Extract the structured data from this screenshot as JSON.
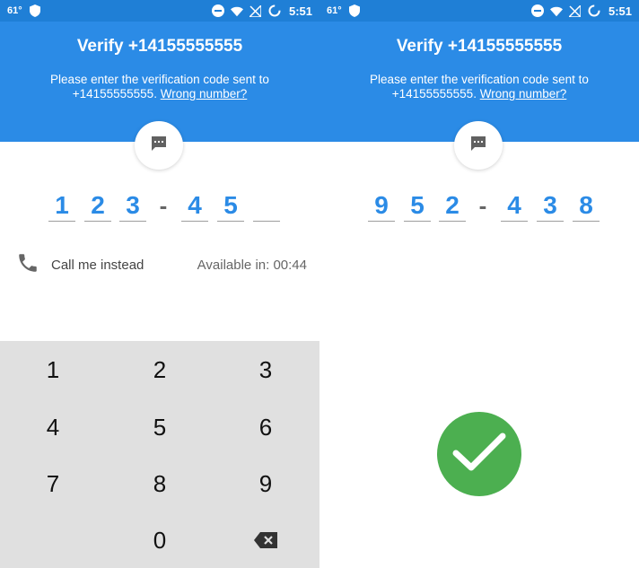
{
  "status_bar": {
    "temperature": "61°",
    "time": "5:51"
  },
  "left": {
    "title": "Verify +14155555555",
    "subtitle_text": "Please enter the verification code sent to +14155555555.",
    "wrong_number_link": "Wrong number?",
    "code_digits": [
      "1",
      "2",
      "3",
      "4",
      "5",
      ""
    ],
    "separator": "-",
    "call_me_label": "Call me instead",
    "available_text": "Available in: 00:44",
    "keypad": {
      "keys": [
        "1",
        "2",
        "3",
        "4",
        "5",
        "6",
        "7",
        "8",
        "9",
        "0"
      ]
    }
  },
  "right": {
    "title": "Verify +14155555555",
    "subtitle_text": "Please enter the verification code sent to +14155555555.",
    "wrong_number_link": "Wrong number?",
    "code_digits": [
      "9",
      "5",
      "2",
      "4",
      "3",
      "8"
    ],
    "separator": "-"
  },
  "icons": {
    "message": "message-icon",
    "phone": "phone-icon",
    "backspace": "backspace-icon",
    "success": "checkmark-icon"
  },
  "colors": {
    "header": "#2b8be6",
    "status_bar": "#1f7fd6",
    "digit": "#2b8be6",
    "keypad": "#e0e0e0",
    "success": "#4caf50"
  }
}
